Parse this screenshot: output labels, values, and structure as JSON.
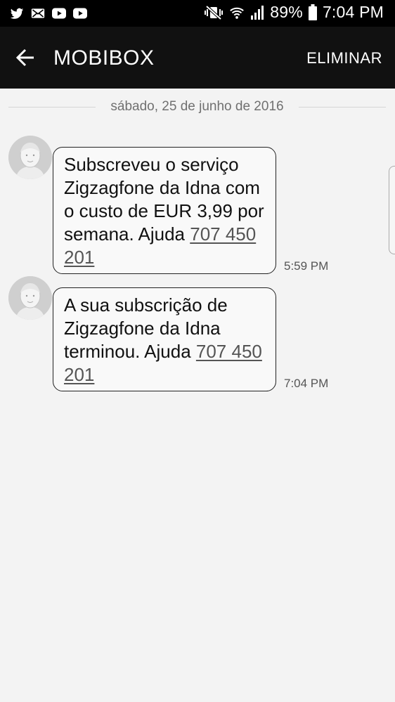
{
  "status_bar": {
    "icons_left": [
      "twitter-icon",
      "mail-icon",
      "youtube-icon",
      "youtube-icon"
    ],
    "icons_right": [
      "mute-vibrate-icon",
      "wifi-icon",
      "signal-icon",
      "battery-icon"
    ],
    "battery": "89%",
    "time": "7:04 PM"
  },
  "app_bar": {
    "title": "MOBIBOX",
    "delete_label": "ELIMINAR"
  },
  "conversation": {
    "date": "sábado, 25 de junho de 2016",
    "messages": [
      {
        "text": "Subscreveu o serviço Zigzagfone da Idna com o custo de EUR 3,99 por semana. Ajuda ",
        "link": "707 450 201",
        "time": "5:59 PM"
      },
      {
        "text": "A sua subscrição de Zigzagfone da Idna terminou. Ajuda ",
        "link": "707 450 201",
        "time": "7:04 PM"
      }
    ]
  }
}
